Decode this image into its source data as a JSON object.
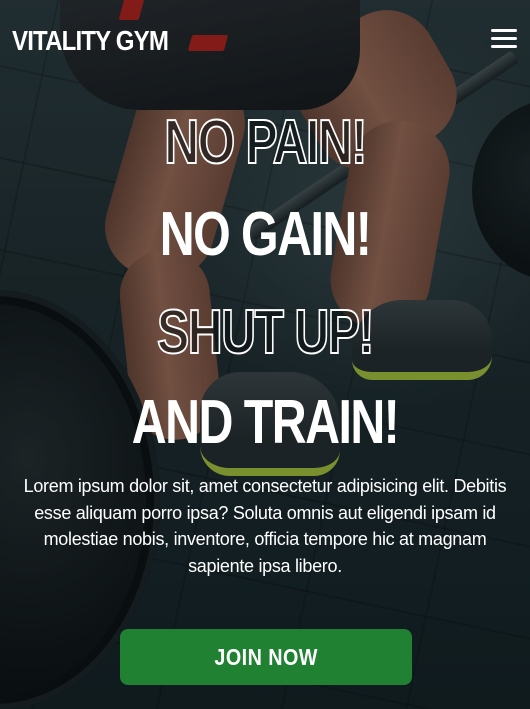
{
  "header": {
    "brand": "VITALITY GYM",
    "menu_icon": "hamburger-menu-icon"
  },
  "hero": {
    "slogan_lines": [
      "NO PAIN!",
      "NO GAIN!",
      "SHUT UP!",
      "AND TRAIN!"
    ],
    "description": "Lorem ipsum dolor sit, amet consectetur adipisicing elit. Debitis esse aliquam porro ipsa? Soluta omnis aut eligendi ipsam id molestiae nobis, inventore, officia tempore hic at magnam sapiente ipsa libero.",
    "cta_label": "JOIN NOW"
  },
  "colors": {
    "cta_background": "#1f8131",
    "text": "#ffffff",
    "shoe_accent": "#a7c23b",
    "shorts_accent": "#b3201c"
  }
}
